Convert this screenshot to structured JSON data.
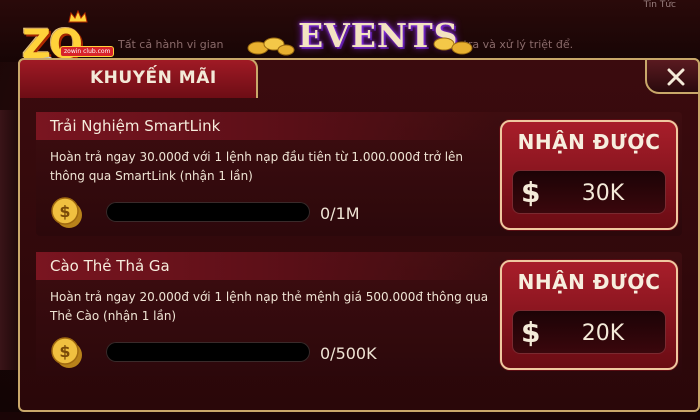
{
  "logo": {
    "text": "ZO",
    "domain": "zowin club.com"
  },
  "header": {
    "title": "EVENTS",
    "notice_left": "Tất cả hành vi gian",
    "notice_right": "tra và xử lý triệt để.",
    "corner_tab": "Tin Tức"
  },
  "panel": {
    "tab_label": "KHUYẾN MÃI",
    "close_icon": "close-icon"
  },
  "events": [
    {
      "title": "Trải Nghiệm SmartLink",
      "description": "Hoàn trả ngay 30.000đ với 1 lệnh nạp đầu tiên từ 1.000.000đ trở lên thông qua SmartLink (nhận 1 lần)",
      "progress_text": "0/1M",
      "progress_fraction": 0,
      "reward_label": "NHẬN ĐƯỢC",
      "reward_currency": "$",
      "reward_amount": "30K"
    },
    {
      "title": "Cào Thẻ Thả Ga",
      "description": "Hoàn trả ngay 20.000đ với 1 lệnh nạp thẻ mệnh giá 500.000đ thông qua Thẻ Cào (nhận 1 lần)",
      "progress_text": "0/500K",
      "progress_fraction": 0,
      "reward_label": "NHẬN ĐƯỢC",
      "reward_currency": "$",
      "reward_amount": "20K"
    }
  ],
  "colors": {
    "panel_border": "#c9a86a",
    "reward_bg": "#a81e2a",
    "gold": "#ffd23a"
  }
}
